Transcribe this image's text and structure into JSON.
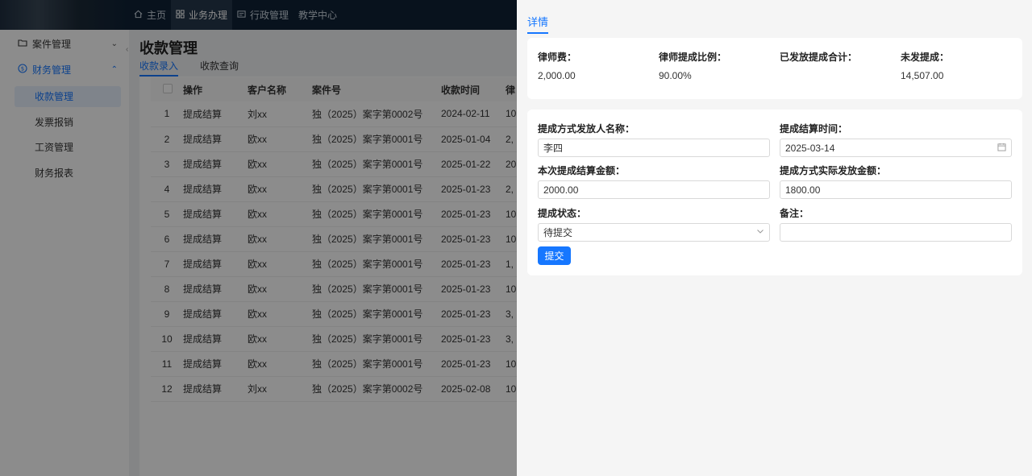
{
  "topnav": {
    "items": [
      {
        "label": "主页",
        "icon": "home-icon"
      },
      {
        "label": "业务办理",
        "icon": "grid-icon"
      },
      {
        "label": "行政管理",
        "icon": "card-icon"
      },
      {
        "label": "教学中心",
        "icon": ""
      }
    ]
  },
  "sidebar": {
    "groups": [
      {
        "label": "案件管理",
        "icon": "folder-icon"
      },
      {
        "label": "财务管理",
        "icon": "finance-icon"
      }
    ],
    "items": [
      "收款管理",
      "发票报销",
      "工资管理",
      "财务报表"
    ]
  },
  "main": {
    "title": "收款管理",
    "tabs": [
      "收款录入",
      "收款查询"
    ],
    "columns": [
      "操作",
      "客户名称",
      "案件号",
      "收款时间",
      "律"
    ],
    "rows": [
      [
        "1",
        "提成结算",
        "刘xx",
        "独（2025）案字第0002号",
        "2024-02-11",
        "10"
      ],
      [
        "2",
        "提成结算",
        "欧xx",
        "独（2025）案字第0001号",
        "2025-01-04",
        "2,"
      ],
      [
        "3",
        "提成结算",
        "欧xx",
        "独（2025）案字第0001号",
        "2025-01-22",
        "20"
      ],
      [
        "4",
        "提成结算",
        "欧xx",
        "独（2025）案字第0001号",
        "2025-01-23",
        "2,"
      ],
      [
        "5",
        "提成结算",
        "欧xx",
        "独（2025）案字第0001号",
        "2025-01-23",
        "10"
      ],
      [
        "6",
        "提成结算",
        "欧xx",
        "独（2025）案字第0001号",
        "2025-01-23",
        "10"
      ],
      [
        "7",
        "提成结算",
        "欧xx",
        "独（2025）案字第0001号",
        "2025-01-23",
        "1,"
      ],
      [
        "8",
        "提成结算",
        "欧xx",
        "独（2025）案字第0001号",
        "2025-01-23",
        "10"
      ],
      [
        "9",
        "提成结算",
        "欧xx",
        "独（2025）案字第0001号",
        "2025-01-23",
        "3,"
      ],
      [
        "10",
        "提成结算",
        "欧xx",
        "独（2025）案字第0001号",
        "2025-01-23",
        "3,"
      ],
      [
        "11",
        "提成结算",
        "欧xx",
        "独（2025）案字第0001号",
        "2025-01-23",
        "10"
      ],
      [
        "12",
        "提成结算",
        "刘xx",
        "独（2025）案字第0002号",
        "2025-02-08",
        "10"
      ]
    ]
  },
  "drawer": {
    "tab": "详情",
    "stats": [
      {
        "label": "律师费：",
        "value": "2,000.00"
      },
      {
        "label": "律师提成比例：",
        "value": "90.00%"
      },
      {
        "label": "已发放提成合计：",
        "value": ""
      },
      {
        "label": "未发提成：",
        "value": "14,507.00"
      }
    ],
    "form": {
      "payer_label": "提成方式发放人名称：",
      "payer_value": "李四",
      "settle_time_label": "提成结算时间：",
      "settle_time_value": "2025-03-14",
      "amount_label": "本次提成结算金额：",
      "amount_value": "2000.00",
      "actual_label": "提成方式实际发放金额：",
      "actual_value": "1800.00",
      "status_label": "提成状态：",
      "status_value": "待提交",
      "remark_label": "备注：",
      "remark_value": "",
      "submit_label": "提交"
    }
  },
  "colors": {
    "accent": "#1677ff",
    "topbar": "#0f2236",
    "mask": "rgba(0,0,0,0.45)"
  }
}
